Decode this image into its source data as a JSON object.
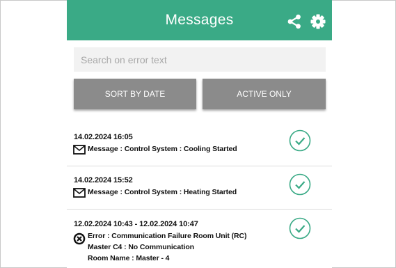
{
  "header": {
    "title": "Messages",
    "color": "#3aaa86",
    "share_icon": "share-icon",
    "settings_icon": "gear-icon"
  },
  "search": {
    "placeholder": "Search on error text",
    "value": ""
  },
  "buttons": {
    "sort_label": "SORT BY DATE",
    "active_label": "ACTIVE ONLY"
  },
  "messages": [
    {
      "timestamp": "14.02.2024 16:05",
      "icon": "envelope-icon",
      "lines": [
        "Message : Control System : Cooling Started"
      ],
      "status_icon": "check-circle-icon"
    },
    {
      "timestamp": "14.02.2024 15:52",
      "icon": "envelope-icon",
      "lines": [
        "Message : Control System : Heating Started"
      ],
      "status_icon": "check-circle-icon"
    },
    {
      "timestamp": "12.02.2024 10:43 - 12.02.2024 10:47",
      "icon": "error-x-circle-icon",
      "lines": [
        "Error : Communication Failure Room Unit (RC)",
        "Master C4 : No Communication",
        "Room Name : Master - 4"
      ],
      "status_icon": "check-circle-icon"
    }
  ]
}
